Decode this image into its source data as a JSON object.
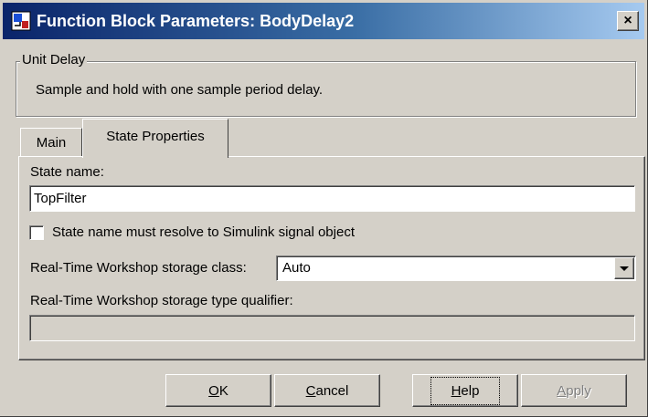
{
  "window": {
    "title": "Function Block Parameters: BodyDelay2",
    "close_label": "×"
  },
  "group": {
    "legend": "Unit Delay",
    "description": "Sample and hold with one sample period delay."
  },
  "tabs": [
    {
      "label": "Main",
      "selected": false
    },
    {
      "label": "State Properties",
      "selected": true
    }
  ],
  "state": {
    "state_name_label": "State name:",
    "state_name_value": "TopFilter",
    "checkbox_label": "State name must resolve to Simulink signal object",
    "checkbox_checked": false,
    "storage_class_label": "Real-Time Workshop storage class:",
    "storage_class_value": "Auto",
    "type_qualifier_label": "Real-Time Workshop storage type qualifier:",
    "type_qualifier_value": ""
  },
  "buttons": {
    "ok": {
      "mnemonic": "O",
      "rest": "K"
    },
    "cancel": {
      "mnemonic": "C",
      "rest": "ancel"
    },
    "help": {
      "mnemonic": "H",
      "rest": "elp"
    },
    "apply": {
      "mnemonic": "A",
      "rest": "pply"
    }
  },
  "colors": {
    "titlebar_start": "#0a246a",
    "titlebar_end": "#a6caf0",
    "face": "#d4d0c8"
  }
}
